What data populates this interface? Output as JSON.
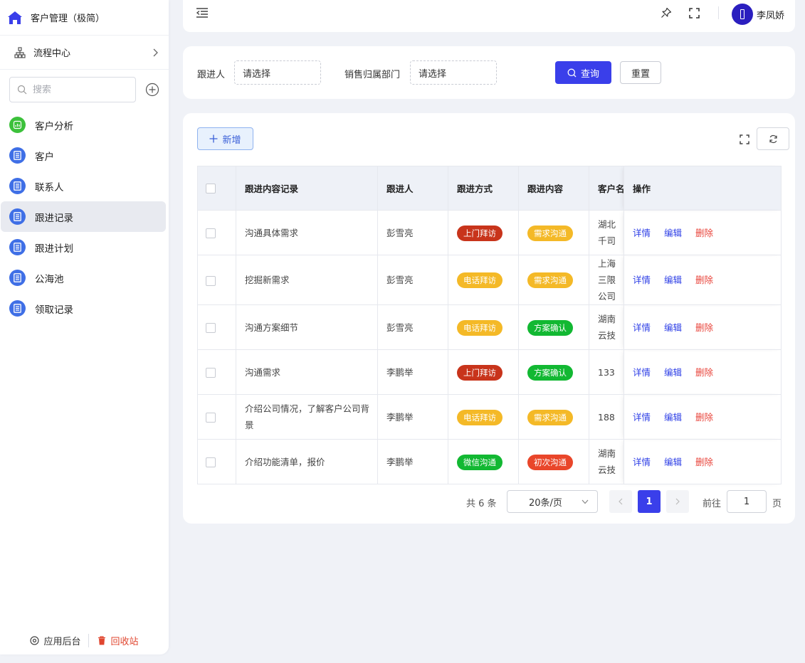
{
  "app": {
    "title": "客户管理（极简）"
  },
  "flow": {
    "label": "流程中心"
  },
  "search": {
    "placeholder": "搜索"
  },
  "menu": [
    {
      "label": "客户分析",
      "icon": "chart-icon",
      "color": "#3cc13b"
    },
    {
      "label": "客户",
      "icon": "list-icon",
      "color": "#3f6fe6"
    },
    {
      "label": "联系人",
      "icon": "list-icon",
      "color": "#3f6fe6"
    },
    {
      "label": "跟进记录",
      "icon": "list-icon",
      "color": "#3f6fe6",
      "active": true
    },
    {
      "label": "跟进计划",
      "icon": "list-icon",
      "color": "#3f6fe6"
    },
    {
      "label": "公海池",
      "icon": "list-icon",
      "color": "#3f6fe6"
    },
    {
      "label": "领取记录",
      "icon": "list-icon",
      "color": "#3f6fe6"
    }
  ],
  "footer": {
    "admin": "应用后台",
    "trash": "回收站"
  },
  "header": {
    "user": "李凤娇"
  },
  "filters": {
    "follower_label": "跟进人",
    "follower_value": "请选择",
    "dept_label": "销售归属部门",
    "dept_value": "请选择",
    "query": "查询",
    "reset": "重置"
  },
  "toolbar": {
    "add": "新增"
  },
  "table": {
    "headers": [
      "跟进内容记录",
      "跟进人",
      "跟进方式",
      "跟进内容",
      "客户名",
      "操作"
    ],
    "rows": [
      {
        "record": "沟通具体需求",
        "person": "彭雪亮",
        "method": "上门拜访",
        "method_color": "red",
        "content": "需求沟通",
        "content_color": "yellow",
        "customer": "湖北千司"
      },
      {
        "record": "挖掘新需求",
        "person": "彭雪亮",
        "method": "电话拜访",
        "method_color": "yellow",
        "content": "需求沟通",
        "content_color": "yellow",
        "customer": "上海三限公司"
      },
      {
        "record": "沟通方案细节",
        "person": "彭雪亮",
        "method": "电话拜访",
        "method_color": "yellow",
        "content": "方案确认",
        "content_color": "green",
        "customer": "湖南云技"
      },
      {
        "record": "沟通需求",
        "person": "李鹏举",
        "method": "上门拜访",
        "method_color": "red",
        "content": "方案确认",
        "content_color": "green",
        "customer": "133"
      },
      {
        "record": "介绍公司情况，了解客户公司背景",
        "person": "李鹏举",
        "method": "电话拜访",
        "method_color": "yellow",
        "content": "需求沟通",
        "content_color": "yellow",
        "customer": "188"
      },
      {
        "record": "介绍功能清单，报价",
        "person": "李鹏举",
        "method": "微信沟通",
        "method_color": "green",
        "content": "初次沟通",
        "content_color": "orange",
        "customer": "湖南云技"
      }
    ],
    "ops": {
      "detail": "详情",
      "edit": "编辑",
      "delete": "删除"
    }
  },
  "pager": {
    "total": "共 6 条",
    "size": "20条/页",
    "current": "1",
    "goto": "前往",
    "goto_value": "1",
    "page_word": "页"
  }
}
